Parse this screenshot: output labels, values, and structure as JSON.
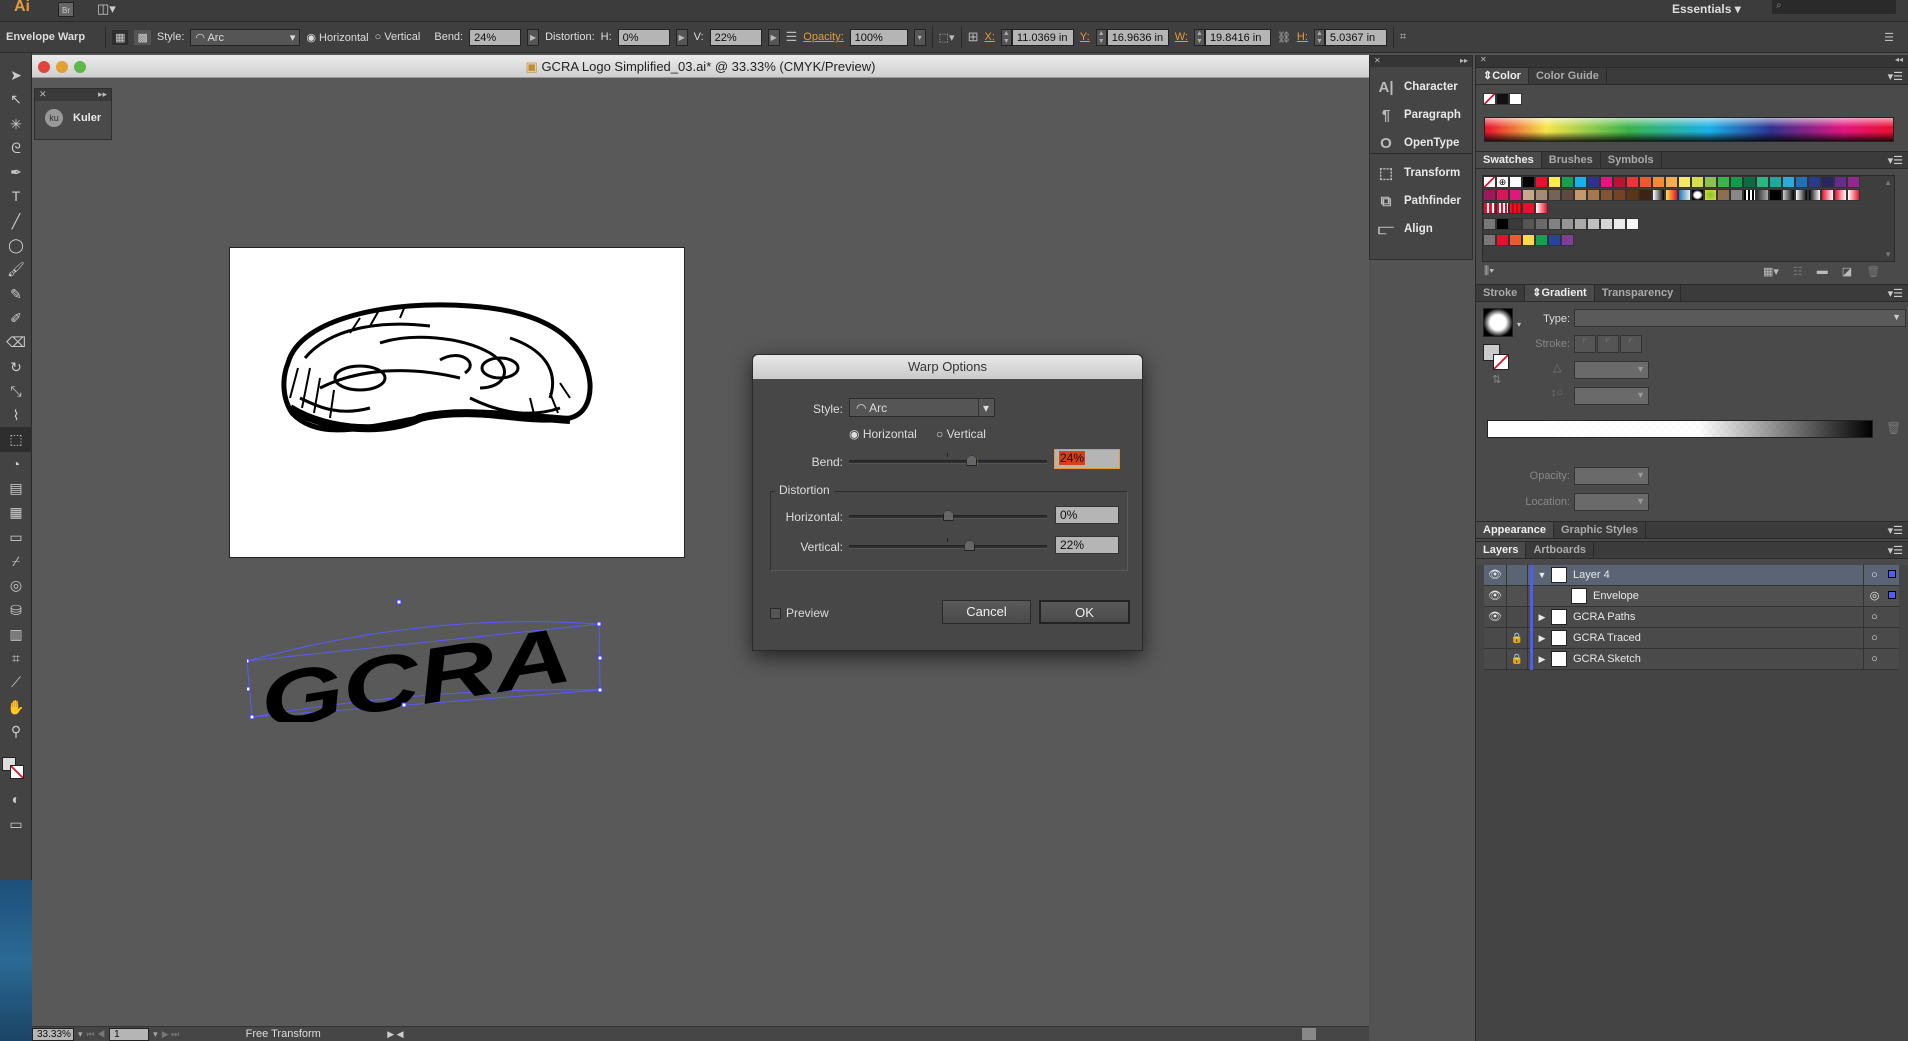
{
  "appbar": {
    "logo": "Ai",
    "bridge": "Br",
    "workspace": "Essentials",
    "search_placeholder": ""
  },
  "control": {
    "tool_label": "Envelope Warp",
    "style_label": "Style:",
    "style_value": "Arc",
    "horizontal": "Horizontal",
    "vertical": "Vertical",
    "orientation_selected": "horizontal",
    "bend_label": "Bend:",
    "bend": "24%",
    "distortion_label": "Distortion:",
    "h_label": "H:",
    "h_value": "0%",
    "v_label": "V:",
    "v_value": "22%",
    "opacity_label": "Opacity:",
    "opacity": "100%",
    "x_label": "X:",
    "x": "11.0369 in",
    "y_label": "Y:",
    "y": "16.9636 in",
    "w_label": "W:",
    "w": "19.8416 in",
    "h2_label": "H:",
    "h2": "5.0367 in"
  },
  "document": {
    "title": "GCRA Logo Simplified_03.ai* @ 33.33% (CMYK/Preview)",
    "warped_text": "GCRA"
  },
  "kuler": {
    "label": "Kuler",
    "icon_text": "ku"
  },
  "dialog": {
    "title": "Warp Options",
    "style_label": "Style:",
    "style_value": "Arc",
    "horizontal": "Horizontal",
    "vertical": "Vertical",
    "orientation_selected": "horizontal",
    "bend_label": "Bend:",
    "bend": "24%",
    "bend_value": 24,
    "distortion_group": "Distortion",
    "dist_h_label": "Horizontal:",
    "dist_h": "0%",
    "dist_h_value": 0,
    "dist_v_label": "Vertical:",
    "dist_v": "22%",
    "dist_v_value": 22,
    "preview_label": "Preview",
    "preview_checked": false,
    "cancel": "Cancel",
    "ok": "OK"
  },
  "collapsed_panels": [
    {
      "label": "Character",
      "icon": "character-icon",
      "glyph": "A|"
    },
    {
      "label": "Paragraph",
      "icon": "paragraph-icon",
      "glyph": "¶"
    },
    {
      "label": "OpenType",
      "icon": "opentype-icon",
      "glyph": "O"
    },
    {
      "label": "Transform",
      "icon": "transform-icon",
      "glyph": "⬚"
    },
    {
      "label": "Pathfinder",
      "icon": "pathfinder-icon",
      "glyph": "⧉"
    },
    {
      "label": "Align",
      "icon": "align-icon",
      "glyph": "⫍"
    }
  ],
  "color_panel": {
    "tabs": [
      "Color",
      "Color Guide"
    ]
  },
  "swatches_panel": {
    "tabs": [
      "Swatches",
      "Brushes",
      "Symbols"
    ],
    "row1": [
      "#ffffff",
      "#000000",
      "#e8112d",
      "#fdea4b",
      "#14a050",
      "#1ab0e8",
      "#2e3190",
      "#e4157f",
      "#b5152e",
      "#e8343a",
      "#eb5a30",
      "#f08d3c",
      "#f6ad52",
      "#f4e86a",
      "#d3df4f",
      "#8cc152",
      "#3cb44b",
      "#159a4c",
      "#0e6a43",
      "#2fb584",
      "#1fa7a0",
      "#2ea8dd",
      "#2072b6",
      "#273a8f",
      "#272660",
      "#662d91",
      "#92278f"
    ],
    "row2": [
      "#a0175e",
      "#d9155c",
      "#e0177d",
      "#c7a88a",
      "#a68a74",
      "#756455",
      "#5f4a43",
      "#c49a6c",
      "#a57850",
      "#835535",
      "#744324",
      "#5c3418",
      "#3f2211"
    ],
    "row3": [
      "#e8112d",
      "#e8343a",
      "#e8112d"
    ],
    "grays": [
      "#000000",
      "#3a3a3a",
      "#555555",
      "#6a6a6a",
      "#808080",
      "#959595",
      "#aaaaaa",
      "#c0c0c0",
      "#d5d5d5",
      "#eaeaea",
      "#f5f5f5"
    ],
    "brights": [
      "#e8112d",
      "#eb5a30",
      "#fdd94b",
      "#14a050",
      "#27449a",
      "#7f3f98"
    ]
  },
  "gradient_panel": {
    "tabs": [
      "Stroke",
      "Gradient",
      "Transparency"
    ],
    "type_label": "Type:",
    "stroke_label": "Stroke:",
    "opacity_label": "Opacity:",
    "location_label": "Location:"
  },
  "appearance_tabs": [
    "Appearance",
    "Graphic Styles"
  ],
  "layers_panel": {
    "tabs": [
      "Layers",
      "Artboards"
    ],
    "layers": [
      {
        "name": "Layer 4",
        "visible": true,
        "locked": false,
        "expanded": true,
        "selected": true,
        "indent": 0
      },
      {
        "name": "Envelope",
        "visible": true,
        "locked": false,
        "expanded": null,
        "selected": false,
        "indent": 1
      },
      {
        "name": "GCRA Paths",
        "visible": true,
        "locked": false,
        "expanded": false,
        "selected": false,
        "indent": 0
      },
      {
        "name": "GCRA Traced",
        "visible": false,
        "locked": true,
        "expanded": false,
        "selected": false,
        "indent": 0
      },
      {
        "name": "GCRA Sketch",
        "visible": false,
        "locked": true,
        "expanded": false,
        "selected": false,
        "indent": 0
      }
    ]
  },
  "status": {
    "zoom": "33.33%",
    "artboard": "1",
    "tool": "Free Transform"
  },
  "colors": {
    "accent": "#e59a3a",
    "layer_color": "#4c5ff0",
    "bend_highlight": "#d9401a"
  }
}
